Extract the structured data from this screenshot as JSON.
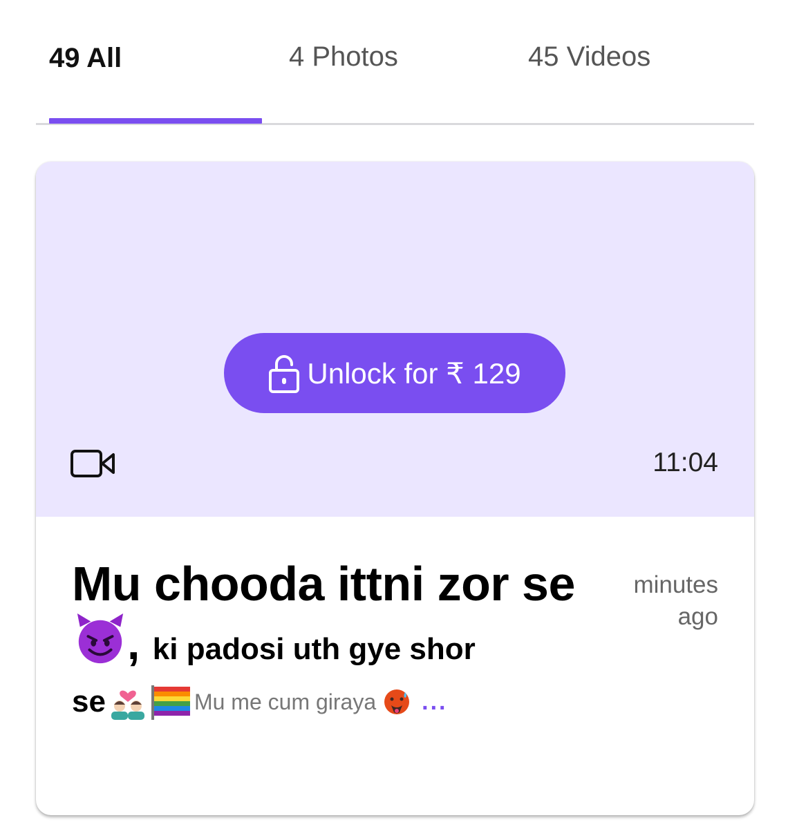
{
  "tabs": {
    "all_label": "49 All",
    "photos_label": "4 Photos",
    "videos_label": "45 Videos",
    "active": "all"
  },
  "colors": {
    "accent": "#7a4ef0",
    "media_background": "#ebe6ff",
    "divider": "#d9d9dc"
  },
  "post": {
    "unlock_label": "Unlock for ₹ 129",
    "media_type_icon": "video-camera-icon",
    "duration": "11:04",
    "time_ago": "minutes ago",
    "title_part1": "Mu chooda ittni zor se",
    "title_comma": ",",
    "title_part2": "ki padosi uth gye shor",
    "title_part3": "se",
    "emojis": [
      "smiling-devil-emoji",
      "couple-with-heart-emoji",
      "rainbow-flag-emoji",
      "hot-face-emoji"
    ],
    "description": "Mu me cum giraya",
    "more_label": "..."
  }
}
